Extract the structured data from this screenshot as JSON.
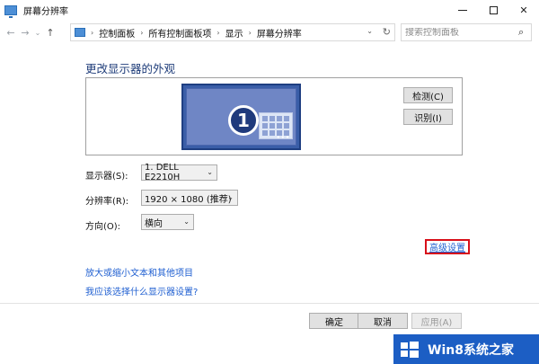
{
  "window": {
    "title": "屏幕分辨率",
    "minimize_icon": "minimize-icon",
    "maximize_icon": "maximize-icon",
    "close_glyph": "✕"
  },
  "nav": {
    "back_glyph": "←",
    "forward_glyph": "→",
    "history_glyph": "⌄",
    "up_glyph": "↑",
    "breadcrumb": [
      "控制面板",
      "所有控制面板项",
      "显示",
      "屏幕分辨率"
    ],
    "separator": "›",
    "dropdown_glyph": "⌄",
    "refresh_glyph": "↻",
    "search_placeholder": "搜索控制面板",
    "search_glyph": "⌕"
  },
  "main": {
    "heading": "更改显示器的外观",
    "monitor_number": "1",
    "monitor_dots": "•••",
    "detect_button": "检测(C)",
    "identify_button": "识别(I)",
    "display_label": "显示器(S):",
    "display_value": "1. DELL E2210H",
    "resolution_label": "分辨率(R):",
    "resolution_value": "1920 × 1080 (推荐)",
    "orientation_label": "方向(O):",
    "orientation_value": "横向",
    "caret_glyph": "⌄",
    "advanced_link": "高级设置",
    "link_enlarge": "放大或缩小文本和其他项目",
    "link_which_settings": "我应该选择什么显示器设置?"
  },
  "footer": {
    "ok": "确定",
    "cancel": "取消",
    "apply": "应用(A)"
  },
  "watermark": {
    "text": "Win8系统之家"
  },
  "colors": {
    "link": "#1f5fd1",
    "heading": "#1f3d7a",
    "highlight_border": "#d8101a",
    "watermark_bg": "#1c5ec4",
    "monitor_blue": "#3a5ea8"
  }
}
